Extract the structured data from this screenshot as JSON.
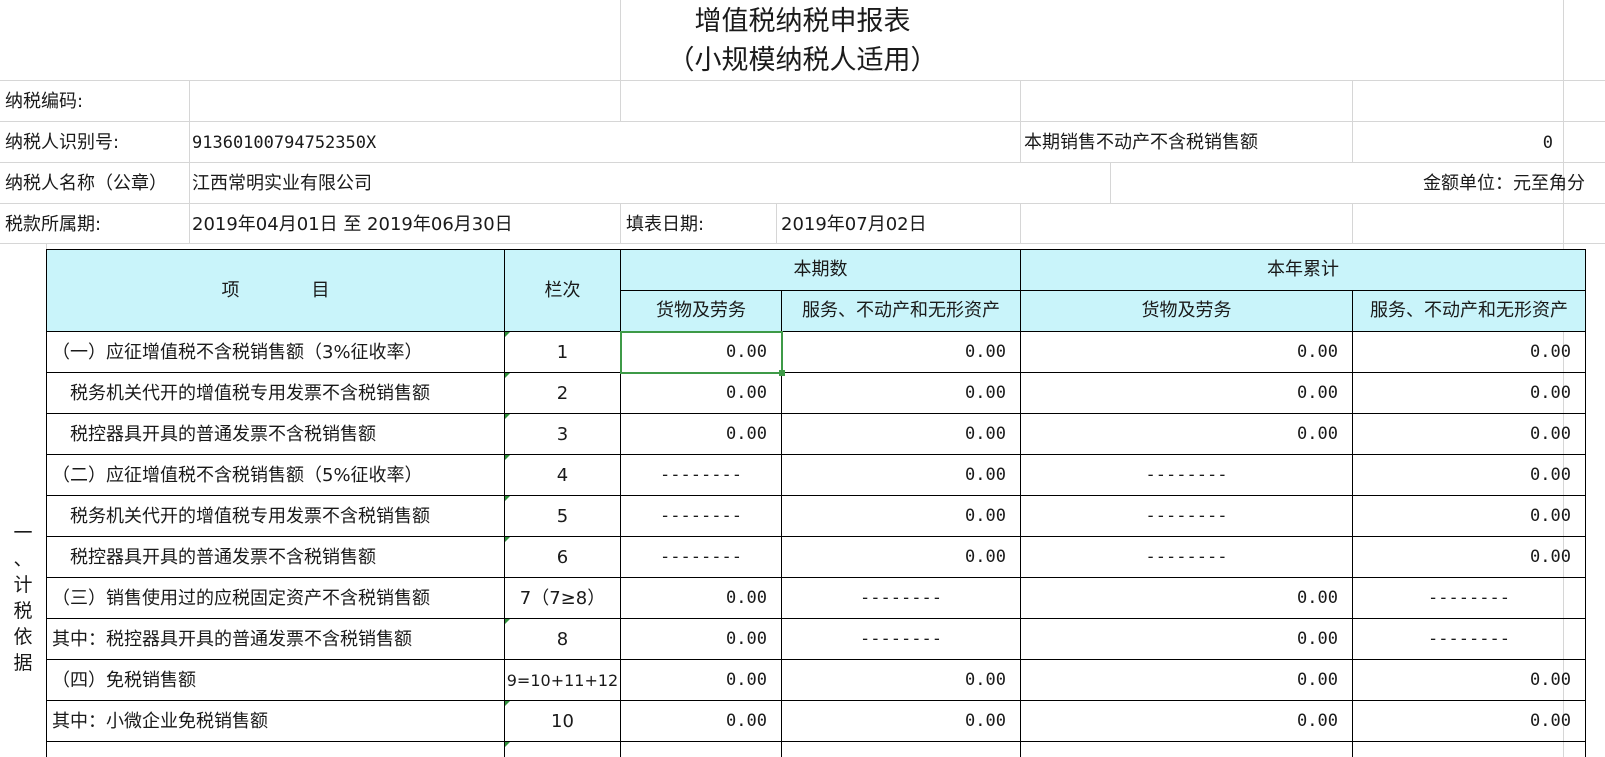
{
  "title": {
    "line1": "增值税纳税申报表",
    "line2": "（小规模纳税人适用）"
  },
  "info": {
    "tax_code_label": "纳税编码:",
    "taxpayer_id_label": "纳税人识别号:",
    "taxpayer_id_value": "91360100794752350X",
    "property_sales_label": "本期销售不动产不含税销售额",
    "property_sales_value": "0",
    "taxpayer_name_label": "纳税人名称（公章）",
    "taxpayer_name_value": "江西常明实业有限公司",
    "unit_label": "金额单位：元至角分",
    "period_label": "税款所属期:",
    "period_value": "2019年04月01日 至 2019年06月30日",
    "fill_date_label": "填表日期:",
    "fill_date_value": "2019年07月02日"
  },
  "header": {
    "item": "项　　　　目",
    "col_index": "栏次",
    "current_period": "本期数",
    "year_total": "本年累计",
    "goods": "货物及劳务",
    "services": "服务、不动产和无形资产"
  },
  "side_label": [
    "一",
    "、",
    "计",
    "税",
    "依",
    "据"
  ],
  "rows": [
    {
      "item": "（一）应征增值税不含税销售额（3%征收率）",
      "idx": "1",
      "c1": "0.00",
      "c2": "0.00",
      "c3": "0.00",
      "c4": "0.00"
    },
    {
      "item": "　税务机关代开的增值税专用发票不含税销售额",
      "idx": "2",
      "c1": "0.00",
      "c2": "0.00",
      "c3": "0.00",
      "c4": "0.00"
    },
    {
      "item": "　税控器具开具的普通发票不含税销售额",
      "idx": "3",
      "c1": "0.00",
      "c2": "0.00",
      "c3": "0.00",
      "c4": "0.00"
    },
    {
      "item": "（二）应征增值税不含税销售额（5%征收率）",
      "idx": "4",
      "c1": "--------",
      "c2": "0.00",
      "c3": "--------",
      "c4": "0.00"
    },
    {
      "item": "　税务机关代开的增值税专用发票不含税销售额",
      "idx": "5",
      "c1": "--------",
      "c2": "0.00",
      "c3": "--------",
      "c4": "0.00"
    },
    {
      "item": "　税控器具开具的普通发票不含税销售额",
      "idx": "6",
      "c1": "--------",
      "c2": "0.00",
      "c3": "--------",
      "c4": "0.00"
    },
    {
      "item": "（三）销售使用过的应税固定资产不含税销售额",
      "idx": "7（7≥8）",
      "c1": "0.00",
      "c2": "--------",
      "c3": "0.00",
      "c4": "--------"
    },
    {
      "item": "其中：税控器具开具的普通发票不含税销售额",
      "idx": "8",
      "c1": "0.00",
      "c2": "--------",
      "c3": "0.00",
      "c4": "--------"
    },
    {
      "item": "（四）免税销售额",
      "idx": "9=10+11+12",
      "c1": "0.00",
      "c2": "0.00",
      "c3": "0.00",
      "c4": "0.00"
    },
    {
      "item": "其中：小微企业免税销售额",
      "idx": "10",
      "c1": "0.00",
      "c2": "0.00",
      "c3": "0.00",
      "c4": "0.00"
    }
  ]
}
